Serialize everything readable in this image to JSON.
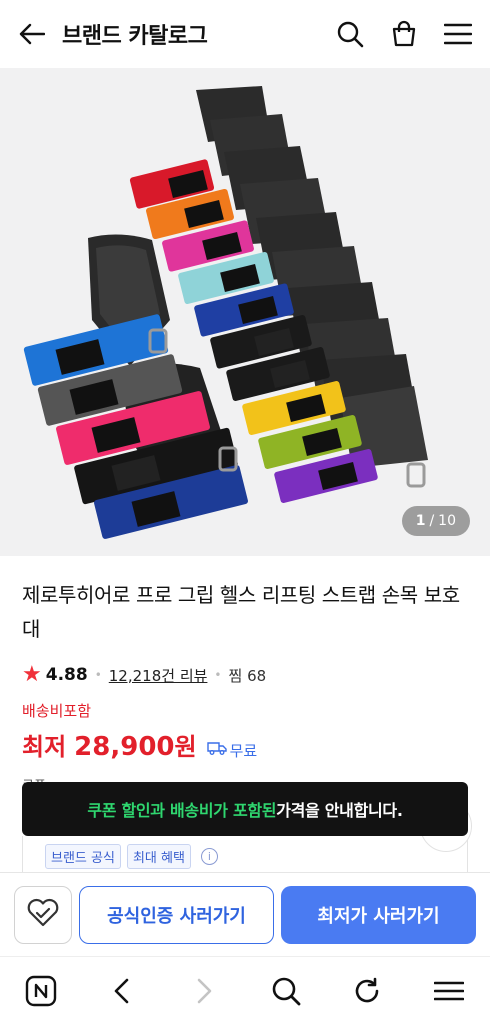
{
  "header": {
    "title": "브랜드 카탈로그",
    "icons": [
      "back-arrow-icon",
      "search-icon",
      "shopping-bag-icon",
      "menu-icon"
    ]
  },
  "gallery": {
    "current": "1",
    "separator": "/",
    "total": "10"
  },
  "product": {
    "name": "제로투히어로 프로 그립 헬스 리프팅 스트랩 손목 보호대",
    "rating": "4.88",
    "reviews": "12,218건 리뷰",
    "zzim": "찜 68",
    "shipping_note": "배송비포함",
    "price_label": "최저",
    "price": "28,900",
    "price_unit": "원",
    "delivery": "무료"
  },
  "clipped_label": "쿠폰",
  "toast": {
    "highlight": "쿠폰 할인과 배송비가 포함된",
    "rest": " 가격을 안내합니다."
  },
  "store": {
    "tags": [
      "브랜드 공식",
      "최대 혜택"
    ],
    "info_symbol": "i"
  },
  "actions": {
    "official_label": "공식인증 사러가기",
    "lowest_label": "최저가 사러가기"
  },
  "colors": {
    "price_red": "#e2202b",
    "brand_blue": "#4a7bf2",
    "toast_green": "#2fd66f",
    "strap_colors": [
      "#d8192a",
      "#f07a1c",
      "#e0359b",
      "#8fd3d8",
      "#1f3fa3",
      "#1a1a1a",
      "#1a1a1a",
      "#f2c21a",
      "#8fb425",
      "#7b2fbf"
    ]
  }
}
